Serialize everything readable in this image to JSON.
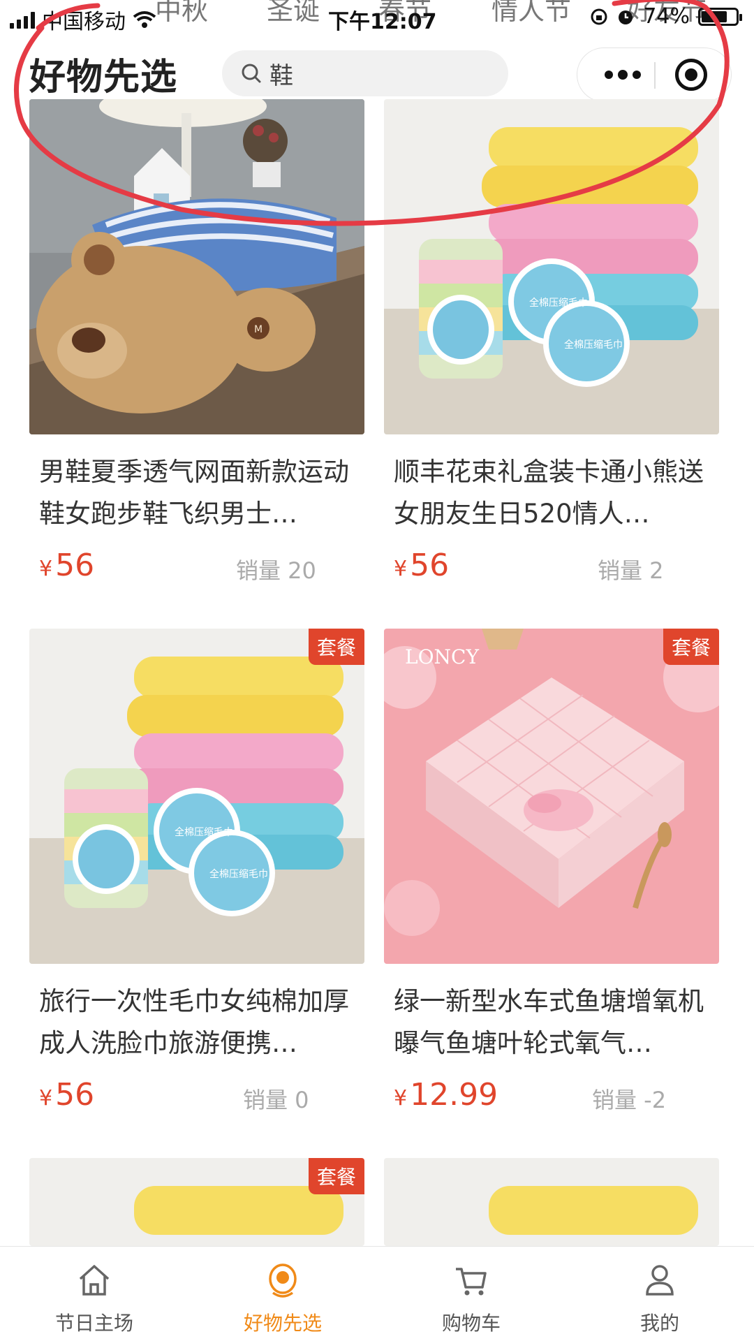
{
  "status_bar": {
    "carrier": "中国移动",
    "time": "下午12:07",
    "battery": "74%",
    "battery_level": 0.74
  },
  "category_strip": [
    "中秋",
    "圣诞",
    "春节",
    "情人节",
    "好友节"
  ],
  "header": {
    "title": "好物先选",
    "search_value": "鞋"
  },
  "products": [
    {
      "name": "男鞋夏季透气网面新款运动鞋女跑步鞋飞织男士…",
      "currency": "¥",
      "price": "56",
      "sales": "销量 20",
      "badge": "",
      "image": "teddy-bear-pillow"
    },
    {
      "name": "顺丰花束礼盒装卡通小熊送女朋友生日520情人…",
      "currency": "¥",
      "price": "56",
      "sales": "销量 2",
      "badge": "",
      "image": "towels-and-compressed-towels"
    },
    {
      "name": "旅行一次性毛巾女纯棉加厚成人洗脸巾旅游便携…",
      "currency": "¥",
      "price": "56",
      "sales": "销量 0",
      "badge": "套餐",
      "image": "towels-and-compressed-towels"
    },
    {
      "name": "绿一新型水车式鱼塘增氧机曝气鱼塘叶轮式氧气…",
      "currency": "¥",
      "price": "12.99",
      "sales": "销量 -2",
      "badge": "套餐",
      "image": "pink-gift-box"
    },
    {
      "name": "",
      "currency": "",
      "price": "",
      "sales": "",
      "badge": "套餐",
      "image": "towels-partial"
    },
    {
      "name": "",
      "currency": "",
      "price": "",
      "sales": "",
      "badge": "",
      "image": "towels-partial"
    }
  ],
  "gift_box_brand": "LONCY",
  "towel_tin_label": "全棉压缩毛巾",
  "tabbar": [
    {
      "label": "节日主场",
      "icon": "home-icon",
      "active": false
    },
    {
      "label": "好物先选",
      "icon": "mascot-icon",
      "active": true
    },
    {
      "label": "购物车",
      "icon": "cart-icon",
      "active": false
    },
    {
      "label": "我的",
      "icon": "user-icon",
      "active": false
    }
  ],
  "colors": {
    "accent": "#f08a18",
    "price": "#e0452c",
    "annotation": "#e53b45"
  }
}
